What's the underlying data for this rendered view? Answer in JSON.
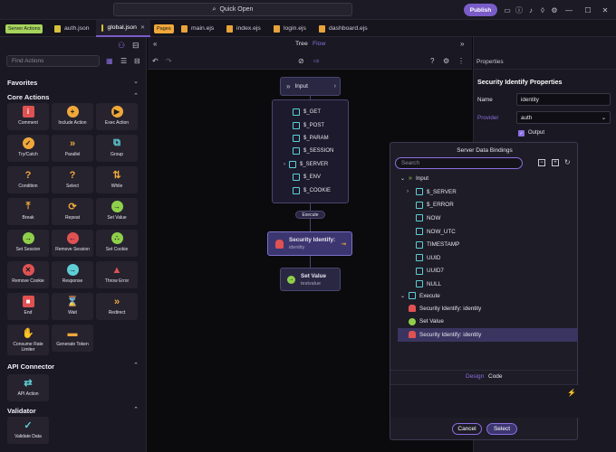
{
  "top": {
    "quick_open": "Quick Open",
    "publish": "Publish"
  },
  "tabs": {
    "server_badge": "Server Actions",
    "left_tabs": [
      "auth.json",
      "global.json"
    ],
    "pages_badge": "Pages",
    "page_tabs": [
      "main.ejs",
      "index.ejs",
      "login.ejs",
      "dashboard.ejs"
    ]
  },
  "left": {
    "find_placeholder": "Find Actions",
    "favorites": "Favorites",
    "core_actions": "Core Actions",
    "core_items": [
      "Comment",
      "Include Action",
      "Exec Action",
      "Try/Catch",
      "Parallel",
      "Group",
      "Condition",
      "Select",
      "While",
      "Break",
      "Repeat",
      "Set Value",
      "Set Session",
      "Remove Session",
      "Set Cookie",
      "Remove Cookie",
      "Response",
      "Throw Error",
      "End",
      "Wait",
      "Redirect",
      "Consume Rate Limiter",
      "Generate Token"
    ],
    "api_connector": "API Connector",
    "api_items": [
      "API Action"
    ],
    "validator": "Validator",
    "validator_items": [
      "Validate Data"
    ]
  },
  "center": {
    "tree": "Tree",
    "flow": "Flow",
    "input_label": "Input",
    "input_items": [
      "$_GET",
      "$_POST",
      "$_PARAM",
      "$_SESSION",
      "$_SERVER",
      "$_ENV",
      "$_COOKIE"
    ],
    "execute_label": "Execute",
    "security_title": "Security Identify:",
    "security_sub": "identity",
    "setvalue_title": "Set Value",
    "setvalue_sub": "testvalue"
  },
  "right": {
    "properties": "Properties",
    "heading": "Security Identify Properties",
    "name_label": "Name",
    "name_value": "identity",
    "provider_label": "Provider",
    "provider_value": "auth",
    "output_label": "Output"
  },
  "dialog": {
    "title": "Server Data Bindings",
    "search_placeholder": "Search",
    "input": "Input",
    "input_items": [
      "$_SERVER",
      "$_ERROR",
      "NOW",
      "NOW_UTC",
      "TIMESTAMP",
      "UUID",
      "UUID7",
      "NULL"
    ],
    "execute": "Execute",
    "exec_items": [
      "Security Identify: identity",
      "Set Value",
      "Security Identify: identity"
    ],
    "design": "Design",
    "code": "Code",
    "cancel": "Cancel",
    "select": "Select"
  },
  "colors": {
    "accent": "#7a5cc8",
    "tile_orange": "#f0a83a",
    "tile_red": "#e05252",
    "tile_green": "#8fd04a",
    "cyan": "#5ecfd6"
  }
}
